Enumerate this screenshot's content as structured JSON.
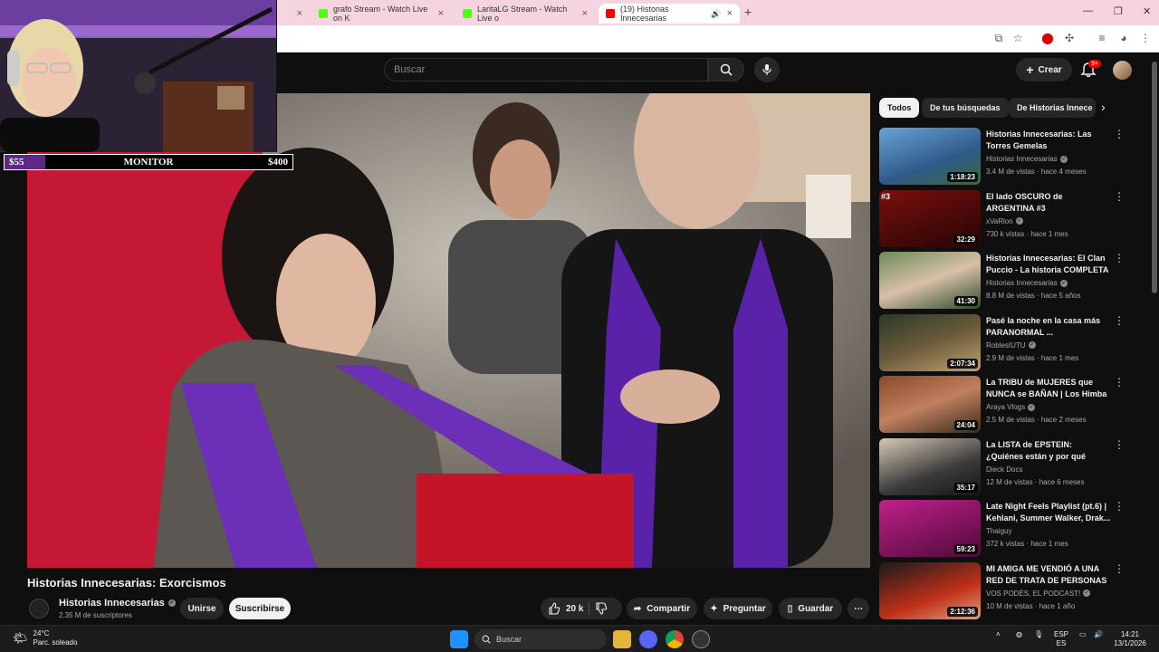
{
  "browser": {
    "tabs": [
      {
        "label": "grafo Stream - Watch Live on K",
        "color": "#53fc18"
      },
      {
        "label": "LaritaLG Stream - Watch Live o",
        "color": "#53fc18"
      },
      {
        "label": "(19) Historias Innecesarias",
        "color": "#ff0000"
      }
    ]
  },
  "youtube": {
    "search_placeholder": "Buscar",
    "create_label": "Crear",
    "notif_badge": "9+"
  },
  "overlay": {
    "left_amount": "$55",
    "label": "MONITOR",
    "right_amount": "$400",
    "progress": 0.14
  },
  "video": {
    "title": "Historias Innecesarias: Exorcismos",
    "channel": "Historias Innecesarias",
    "subscribers": "2.35 M de suscriptores",
    "join_label": "Unirse",
    "subscribe_label": "Suscribirse",
    "likes": "20 k",
    "share_label": "Compartir",
    "ask_label": "Preguntar",
    "save_label": "Guardar"
  },
  "chips": [
    "Todos",
    "De tus búsquedas",
    "De Historias Innece"
  ],
  "recommendations": [
    {
      "title": "Historias Innecesarias: Las Torres Gemelas",
      "channel": "Historias Innecesarias",
      "meta": "3.4 M de vistas · hace 4 meses",
      "duration": "1:18:23",
      "rank": "",
      "verified": true
    },
    {
      "title": "El lado OSCURO de ARGENTINA #3",
      "channel": "xVaRlon",
      "meta": "730 k vistas · hace 1 mes",
      "duration": "32:29",
      "rank": "#3",
      "verified": true
    },
    {
      "title": "Historias Innecesarias: El Clan Puccio - La historia COMPLETA",
      "channel": "Historias Innecesarias",
      "meta": "8.8 M de vistas · hace 5 años",
      "duration": "41:30",
      "rank": "",
      "verified": true
    },
    {
      "title": "Pasé la noche en la casa más PARANORMAL ...",
      "channel": "RoblesIUTU",
      "meta": "2.9 M de vistas · hace 1 mes",
      "duration": "2:07:34",
      "rank": "",
      "verified": true
    },
    {
      "title": "La TRIBU de MUJERES que NUNCA se BAÑAN | Los Himba",
      "channel": "Araya Vlogs",
      "meta": "2.5 M de vistas · hace 2 meses",
      "duration": "24:04",
      "rank": "",
      "verified": true
    },
    {
      "title": "La LISTA de EPSTEIN: ¿Quiénes están y por qué NADIE habla d...",
      "channel": "Dieck Docs",
      "meta": "12 M de vistas · hace 6 meses",
      "duration": "35:17",
      "rank": "",
      "verified": false
    },
    {
      "title": "Late Night Feels Playlist (pt.6) | Kehlani, Summer Walker, Drak...",
      "channel": "Thaiguy",
      "meta": "372 k vistas · hace 1 mes",
      "duration": "59:23",
      "rank": "",
      "verified": false
    },
    {
      "title": "MI AMIGA ME VENDIÓ A UNA RED DE TRATA DE PERSONAS ...",
      "channel": "VOS PODÉS, EL PODCAST!",
      "meta": "10 M de vistas · hace 1 año",
      "duration": "2:12:36",
      "rank": "",
      "verified": true
    }
  ],
  "taskbar": {
    "temp": "24°C",
    "weather": "Parc. soleado",
    "search": "Buscar",
    "lang1": "ESP",
    "lang2": "ES",
    "time": "14:21",
    "date": "13/1/2026"
  }
}
